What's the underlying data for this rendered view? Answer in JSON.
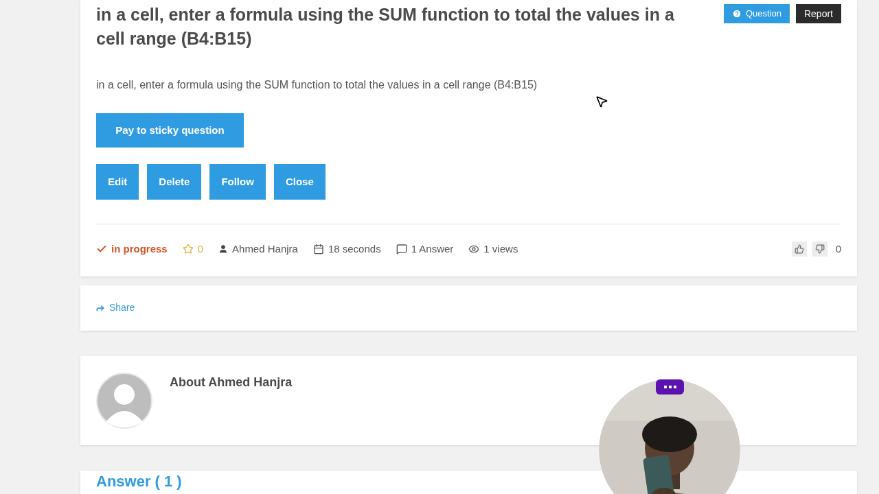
{
  "question": {
    "title": "in a cell, enter a formula using the SUM function to total the values in a cell range (B4:B15)",
    "badges": [
      {
        "label": "Question",
        "kind": "question"
      },
      {
        "label": "Report",
        "kind": "report"
      }
    ],
    "description": "in a cell, enter a formula using the SUM function to total the values in a cell range (B4:B15)",
    "sticky_button": "Pay to sticky question",
    "actions": [
      "Edit",
      "Delete",
      "Follow",
      "Close"
    ],
    "meta": [
      {
        "kind": "status",
        "text": "in progress"
      },
      {
        "kind": "rating",
        "text": "0"
      },
      {
        "kind": "author",
        "text": "Ahmed Hanjra"
      },
      {
        "kind": "time",
        "text": "18 seconds"
      },
      {
        "kind": "answers",
        "text": "1 Answer"
      },
      {
        "kind": "views",
        "text": "1 views"
      }
    ],
    "vote_count": "0"
  },
  "share": {
    "label": "Share"
  },
  "about": {
    "title": "About Ahmed Hanjra"
  },
  "answers": {
    "heading": "Answer ( 1 )"
  }
}
